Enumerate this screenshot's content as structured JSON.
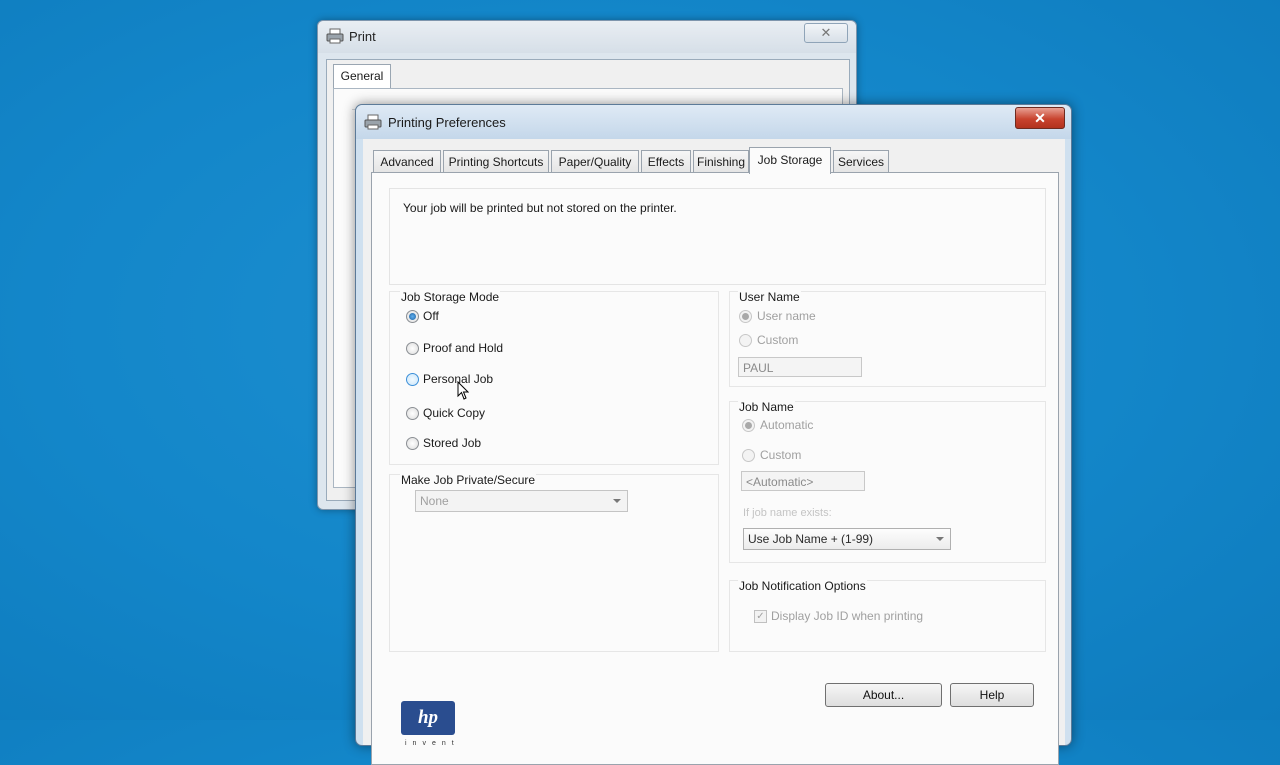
{
  "print_window": {
    "title": "Print",
    "close": "✕",
    "tab": "General"
  },
  "pref_window": {
    "title": "Printing Preferences",
    "close": "✕",
    "tabs": [
      "Advanced",
      "Printing Shortcuts",
      "Paper/Quality",
      "Effects",
      "Finishing",
      "Job Storage",
      "Services"
    ],
    "active_tab": "Job Storage",
    "description": "Your job will be printed but not stored on the printer.",
    "storage_mode": {
      "label": "Job Storage Mode",
      "options": [
        "Off",
        "Proof and Hold",
        "Personal Job",
        "Quick Copy",
        "Stored Job"
      ],
      "selected": "Off",
      "hovered": "Personal Job"
    },
    "private": {
      "label": "Make Job Private/Secure",
      "value": "None"
    },
    "user_name": {
      "label": "User Name",
      "options": [
        "User name",
        "Custom"
      ],
      "selected": "User name",
      "value": "PAUL"
    },
    "job_name": {
      "label": "Job Name",
      "options": [
        "Automatic",
        "Custom"
      ],
      "selected": "Automatic",
      "value": "<Automatic>",
      "exists_label": "If job name exists:",
      "exists_value": "Use Job Name + (1-99)"
    },
    "notification": {
      "label": "Job Notification Options",
      "checkbox_label": "Display Job ID when printing",
      "checked": true
    },
    "buttons": {
      "about": "About...",
      "help": "Help"
    },
    "logo": {
      "mark": "hp",
      "tagline": "invent"
    }
  }
}
